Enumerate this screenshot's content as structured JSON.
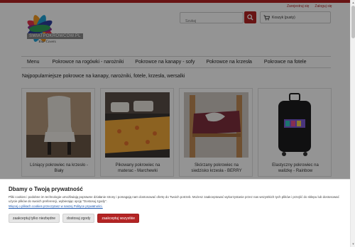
{
  "header": {
    "links": [
      "Zarejestruj się",
      "Zaloguj się"
    ],
    "logo_text": "SWIATPOKROWCOW.PL",
    "logo_tagline": "Your Covers",
    "search": {
      "placeholder": "Szukaj"
    },
    "cart_label": "Koszyk (pusty)"
  },
  "nav": {
    "items": [
      "Menu",
      "Pokrowce na rogówki - narożniki",
      "Pokrowce na kanapy - sofy",
      "Pokrowce na krzesła",
      "Pokrowce na fotele"
    ]
  },
  "main": {
    "headline": "Najpopularniejsze pokrowce na kanapy, narożniki, fotele, krzesła, wersalki",
    "products": [
      {
        "title_line1": "Lśniący pokrowiec na krzesło -",
        "title_line2": "Biały"
      },
      {
        "title_line1": "Pikowany pokrowiec na",
        "title_line2": "materac - Marchewki"
      },
      {
        "title_line1": "Skórzany pokrowiec na",
        "title_line2": "siedzisko krzesła - BERRY"
      },
      {
        "title_line1": "Elastyczny pokrowiec na",
        "title_line2": "walizkę - Rainbow"
      }
    ]
  },
  "cookie": {
    "title": "Dbamy o Twoją prywatność",
    "text": "Pliki cookies i podobne im technologie umożliwiają poprawne działanie strony i pomagają nam dostosować ofertę do Twoich potrzeb. Możesz zaakceptować wykorzystanie przez nas wszystkich tych plików i przejść do sklepu lub dostosować użycie plików do swoich preferencji, wybierając opcję \"Dostosuj zgody\".",
    "link": "Więcej o plikach cookies przeczytasz w naszej Polityce prywatności.",
    "buttons": {
      "necessary": "zaakceptuj tylko niezbędne",
      "customize": "dostosuj zgody",
      "accept_all": "zaakceptuj wszystkie"
    }
  },
  "colors": {
    "accent": "#b32424",
    "overlay": "rgba(0,0,0,0.42)"
  }
}
